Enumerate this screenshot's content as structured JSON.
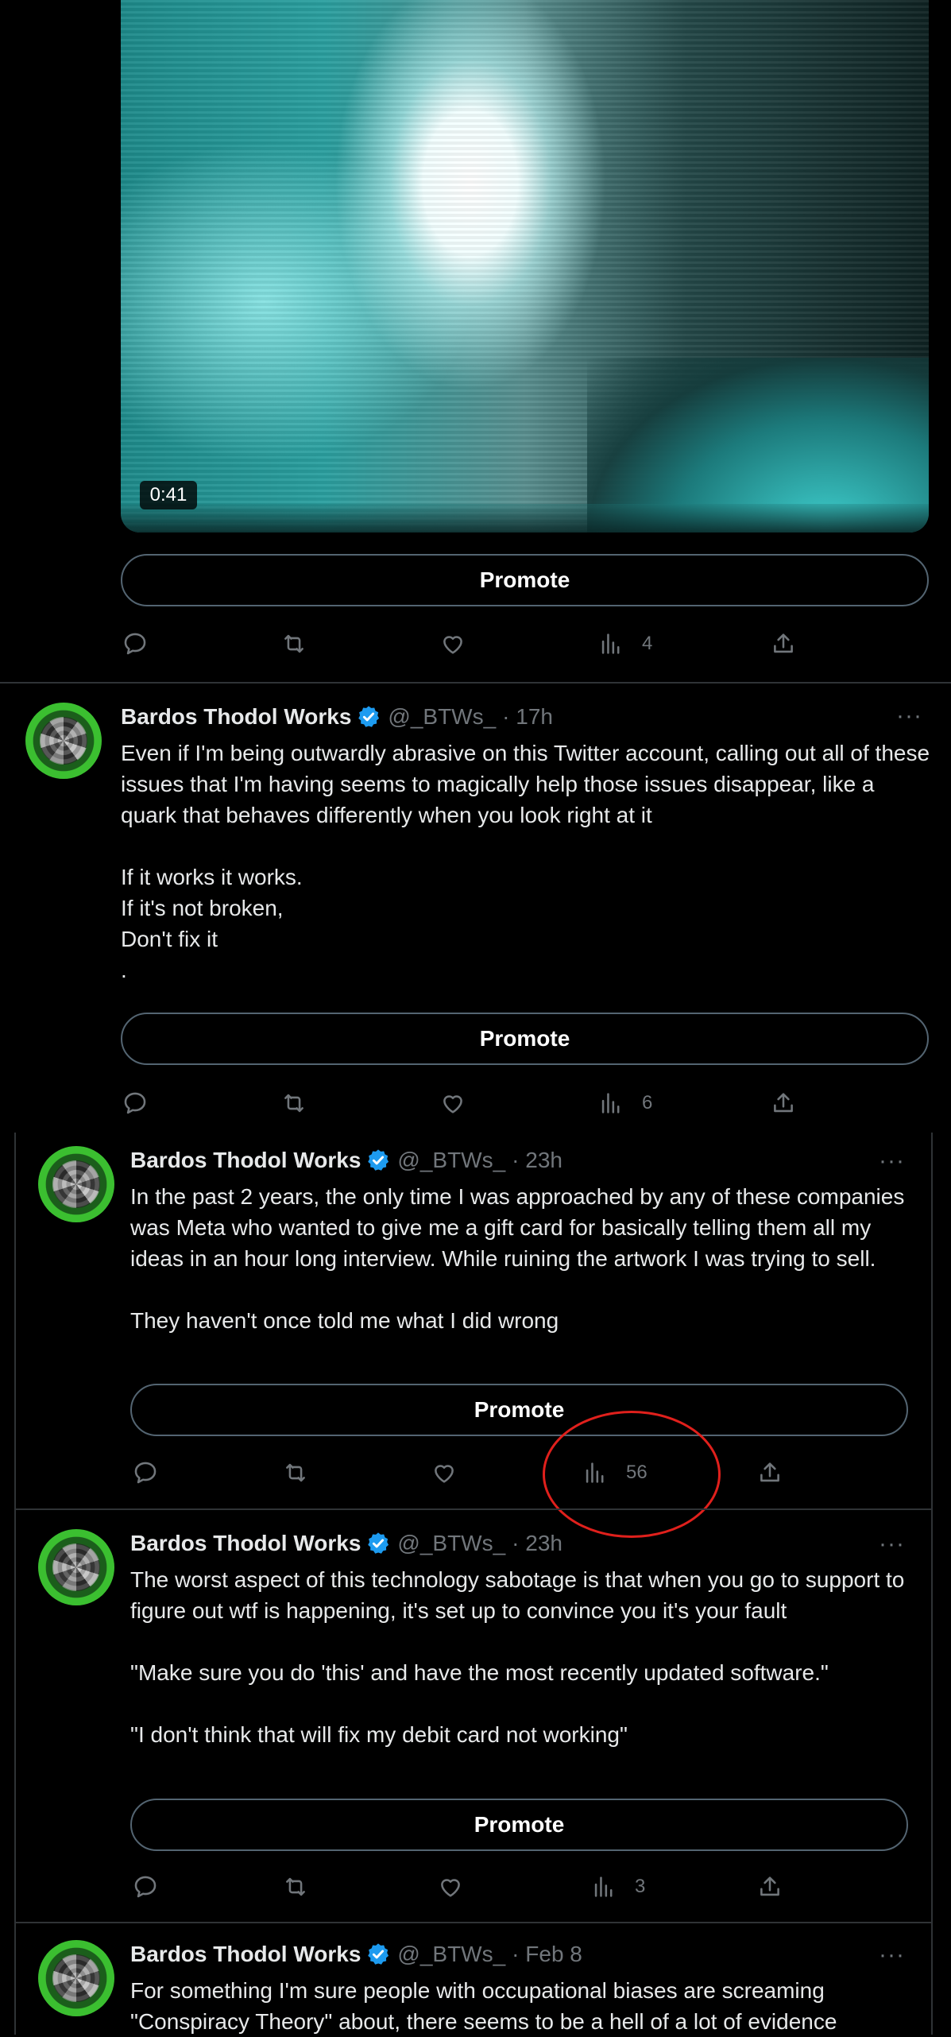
{
  "video": {
    "duration": "0:41"
  },
  "promote_label": "Promote",
  "tweets": [
    {
      "views": "4"
    },
    {
      "author": "Bardos Thodol Works",
      "handle": "@_BTWs_",
      "time": "· 17h",
      "text": "Even if I'm being outwardly abrasive on this Twitter account, calling out all of these issues that I'm having seems to magically help those issues disappear, like a quark that behaves differently when you look right at it\n\nIf it works it works.\nIf it's not broken,\nDon't fix it\n.",
      "views": "6"
    },
    {
      "author": "Bardos Thodol Works",
      "handle": "@_BTWs_",
      "time": "· 23h",
      "text": "In the past 2 years, the only time I was approached by any of these companies was Meta who wanted to give me a gift card for basically telling them all my ideas in an hour long interview. While ruining the artwork I was trying to sell.\n\nThey haven't once told me what I did wrong",
      "views": "56"
    },
    {
      "author": "Bardos Thodol Works",
      "handle": "@_BTWs_",
      "time": "· 23h",
      "text": "The worst aspect of this technology sabotage is that when you go to support to figure out wtf is happening, it's set up to convince you it's your fault\n\n\"Make sure you do 'this' and have the most recently updated software.\"\n\n\"I don't think that will fix my debit card not working\"",
      "views": "3"
    },
    {
      "author": "Bardos Thodol Works",
      "handle": "@_BTWs_",
      "time": "· Feb 8",
      "text": "For something I'm sure people with occupational biases are screaming \"Conspiracy Theory\" about, there seems to be a hell of a lot of evidence"
    }
  ],
  "more_label": "···",
  "colors": {
    "verified": "#1d9bf0",
    "annotation": "#e0201c",
    "muted": "#71767b",
    "border": "#2f3336"
  },
  "icons": [
    "reply-icon",
    "retweet-icon",
    "like-icon",
    "views-icon",
    "share-icon",
    "verified-badge-icon",
    "more-icon"
  ]
}
